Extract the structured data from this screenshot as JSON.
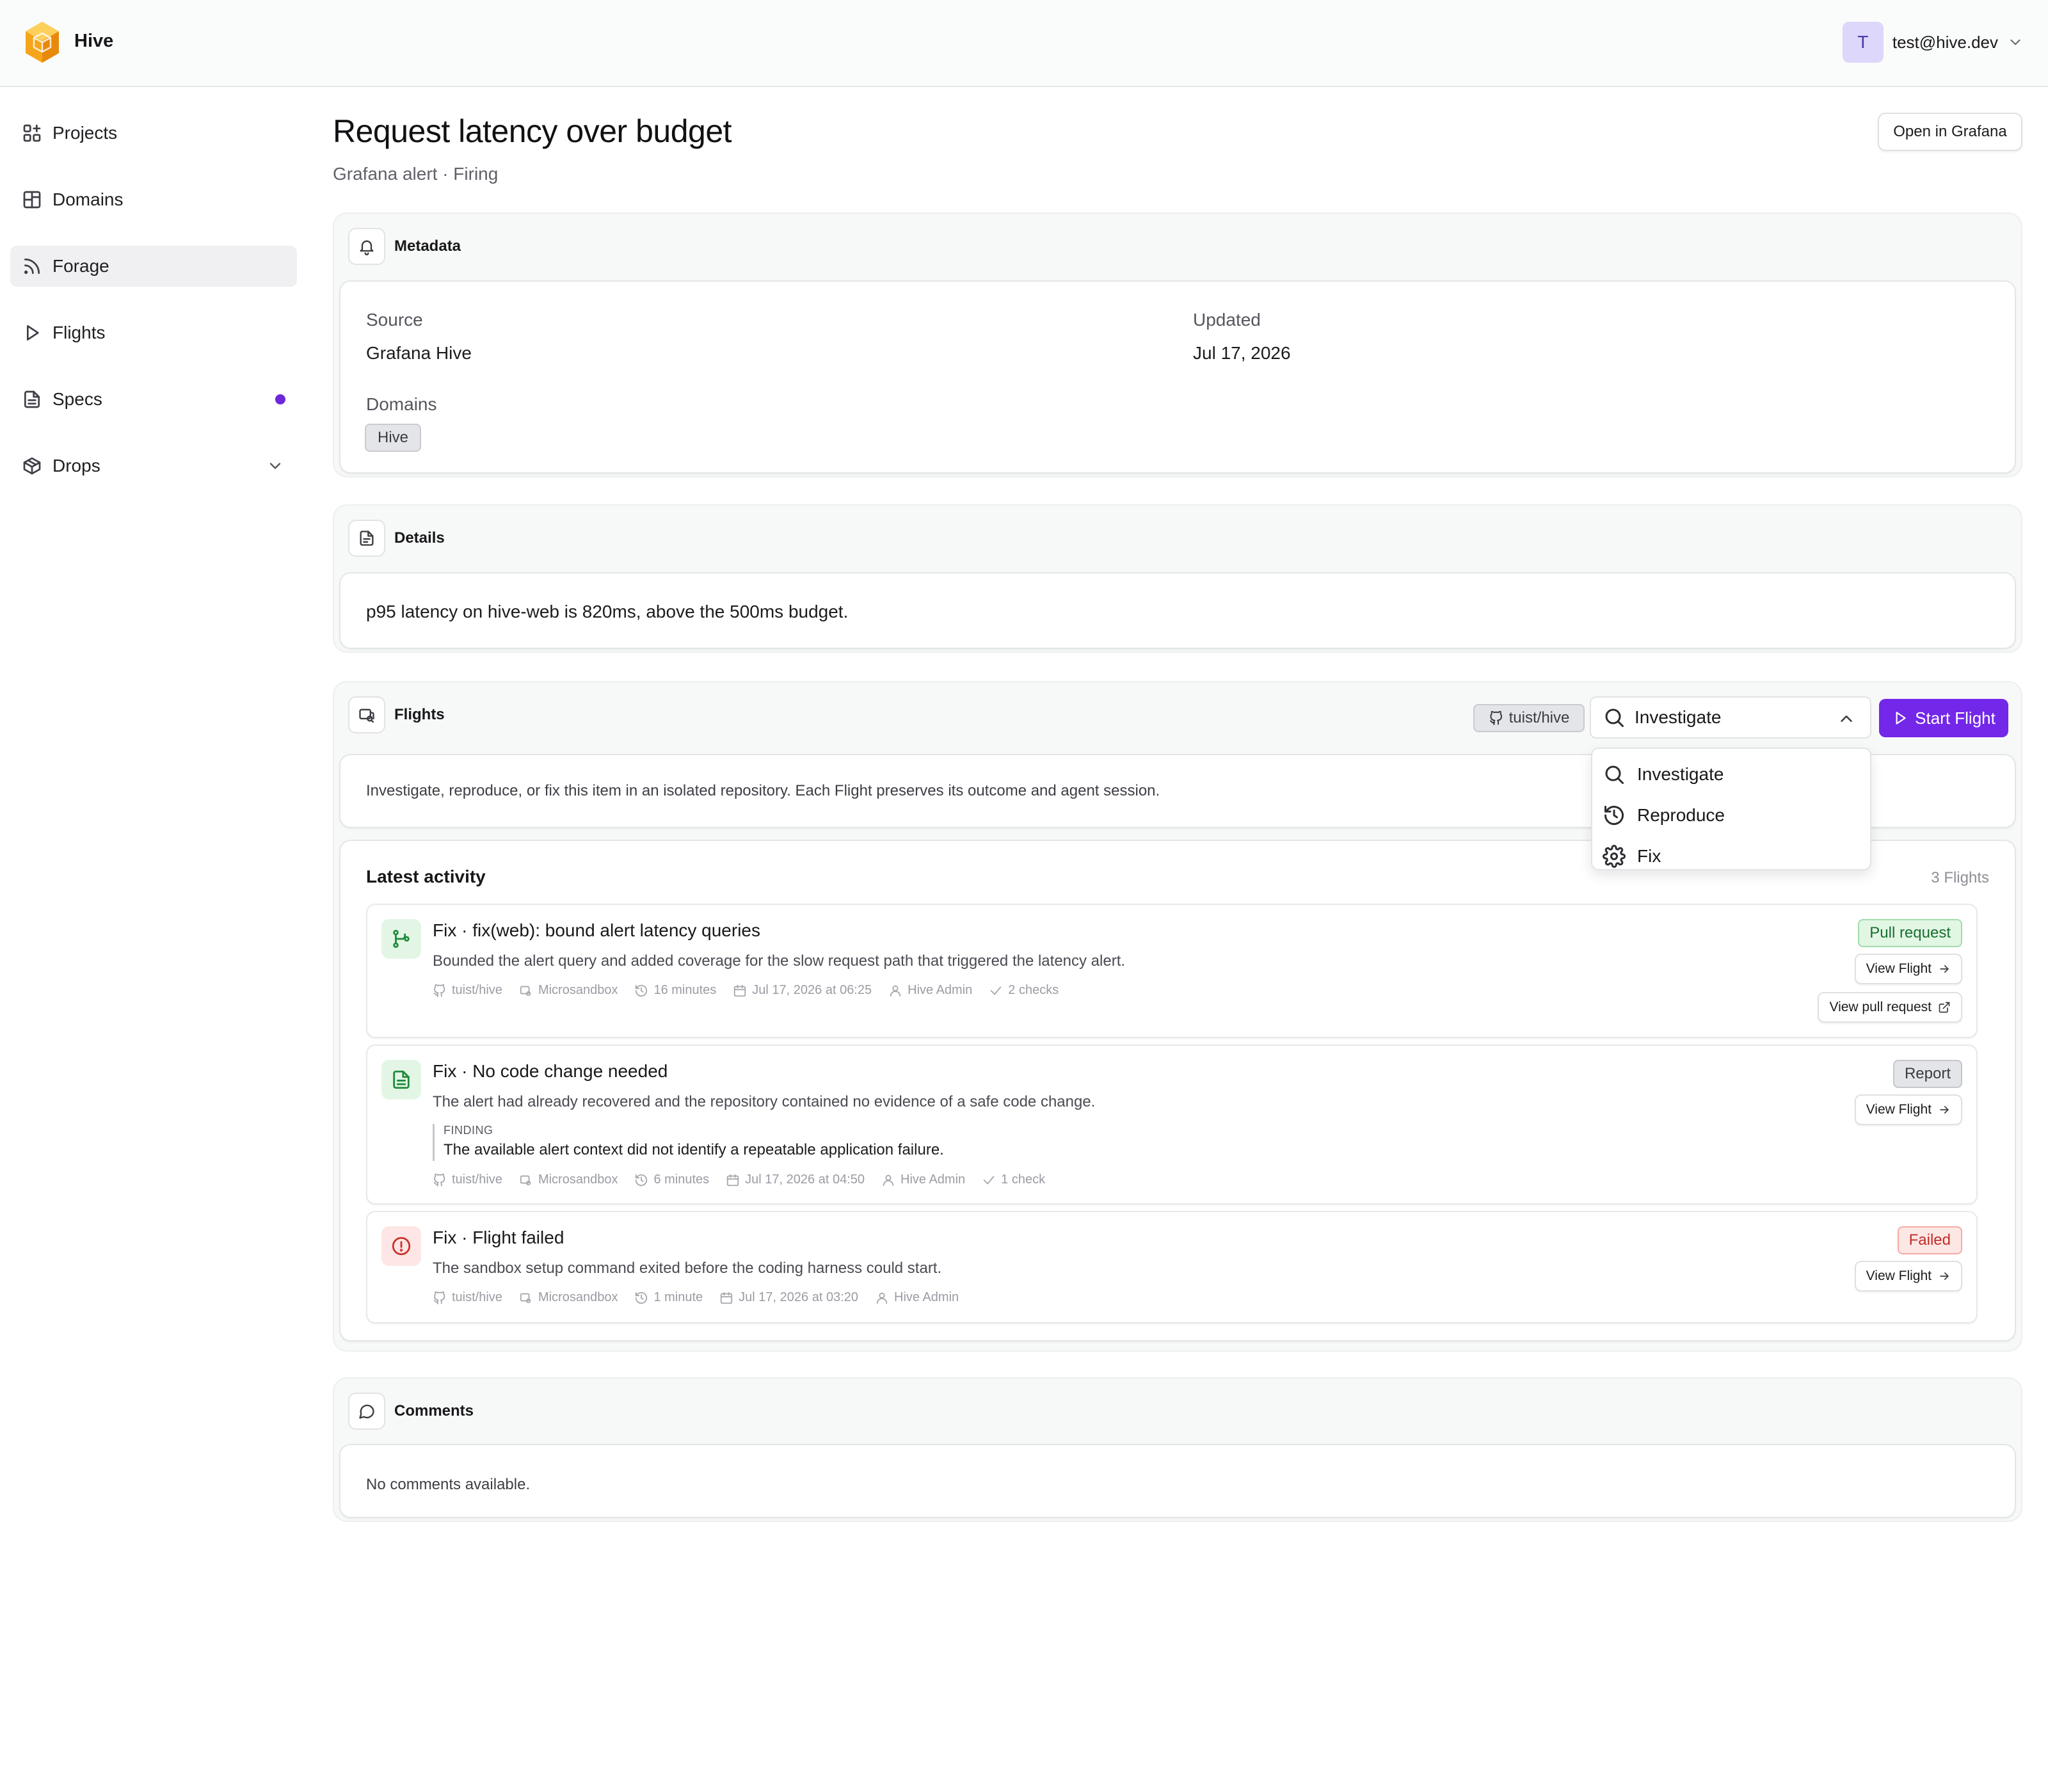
{
  "app": {
    "name": "Hive"
  },
  "user": {
    "initial": "T",
    "email": "test@hive.dev"
  },
  "sidebar": {
    "items": [
      {
        "label": "Projects",
        "icon": "grid-plus-icon"
      },
      {
        "label": "Domains",
        "icon": "layout-icon"
      },
      {
        "label": "Forage",
        "icon": "rss-icon",
        "active": true
      },
      {
        "label": "Flights",
        "icon": "play-icon"
      },
      {
        "label": "Specs",
        "icon": "file-text-icon",
        "notification": true
      },
      {
        "label": "Drops",
        "icon": "package-icon",
        "expandable": true
      }
    ]
  },
  "page": {
    "title": "Request latency over budget",
    "subtitle": "Grafana alert · Firing",
    "open_button": "Open in Grafana"
  },
  "metadata": {
    "title": "Metadata",
    "source_label": "Source",
    "source_value": "Grafana Hive",
    "updated_label": "Updated",
    "updated_value": "Jul 17, 2026",
    "domains_label": "Domains",
    "domains": [
      "Hive"
    ]
  },
  "details": {
    "title": "Details",
    "text": "p95 latency on hive-web is 820ms, above the 500ms budget."
  },
  "flights": {
    "title": "Flights",
    "repo": "tuist/hive",
    "selected_mode": "Investigate",
    "start_label": "Start Flight",
    "description": "Investigate, reproduce, or fix this item in an isolated repository. Each Flight preserves its outcome and agent session.",
    "modes": [
      {
        "label": "Investigate",
        "icon": "search-icon"
      },
      {
        "label": "Reproduce",
        "icon": "history-icon"
      },
      {
        "label": "Fix",
        "icon": "gear-icon"
      }
    ]
  },
  "activity": {
    "title": "Latest activity",
    "count": "3 Flights",
    "items": [
      {
        "title": "Fix · fix(web): bound alert latency queries",
        "description": "Bounded the alert query and added coverage for the slow request path that triggered the latency alert.",
        "status": "Pull request",
        "repo": "tuist/hive",
        "sandbox": "Microsandbox",
        "duration": "16 minutes",
        "date": "Jul 17, 2026 at 06:25",
        "author": "Hive Admin",
        "checks": "2 checks",
        "view_flight": "View Flight",
        "view_pr": "View pull request"
      },
      {
        "title": "Fix · No code change needed",
        "description": "The alert had already recovered and the repository contained no evidence of a safe code change.",
        "status": "Report",
        "finding_label": "FINDING",
        "finding_text": "The available alert context did not identify a repeatable application failure.",
        "repo": "tuist/hive",
        "sandbox": "Microsandbox",
        "duration": "6 minutes",
        "date": "Jul 17, 2026 at 04:50",
        "author": "Hive Admin",
        "checks": "1 check",
        "view_flight": "View Flight"
      },
      {
        "title": "Fix · Flight failed",
        "description": "The sandbox setup command exited before the coding harness could start.",
        "status": "Failed",
        "repo": "tuist/hive",
        "sandbox": "Microsandbox",
        "duration": "1 minute",
        "date": "Jul 17, 2026 at 03:20",
        "author": "Hive Admin",
        "view_flight": "View Flight"
      }
    ]
  },
  "comments": {
    "title": "Comments",
    "empty": "No comments available."
  },
  "colors": {
    "accent": "#7327e8",
    "success": "#17702e",
    "danger": "#c02d27"
  }
}
